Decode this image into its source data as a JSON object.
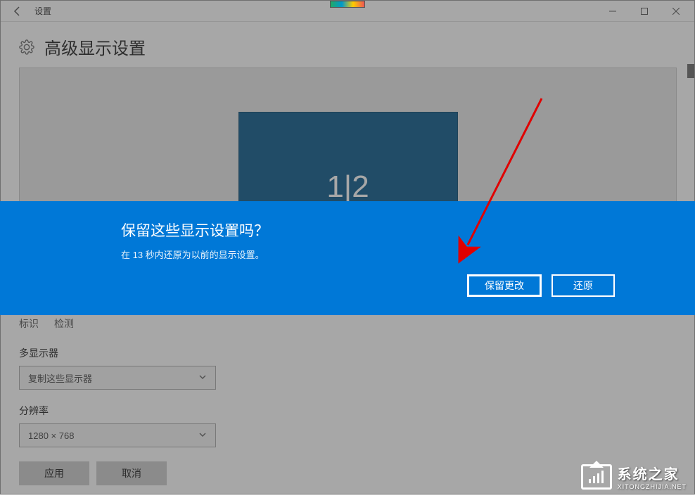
{
  "window": {
    "title": "设置"
  },
  "page": {
    "title": "高级显示设置"
  },
  "monitor": {
    "label": "1|2"
  },
  "links": {
    "identify": "标识",
    "detect": "检测"
  },
  "multi_display": {
    "label": "多显示器",
    "value": "复制这些显示器"
  },
  "resolution": {
    "label": "分辨率",
    "value": "1280 × 768"
  },
  "buttons": {
    "apply": "应用",
    "cancel": "取消"
  },
  "dialog": {
    "title": "保留这些显示设置吗？",
    "message": "在 13 秒内还原为以前的显示设置。",
    "keep": "保留更改",
    "revert": "还原"
  },
  "watermark": {
    "cn": "系统之家",
    "en": "XITONGZHIJIA.NET"
  }
}
